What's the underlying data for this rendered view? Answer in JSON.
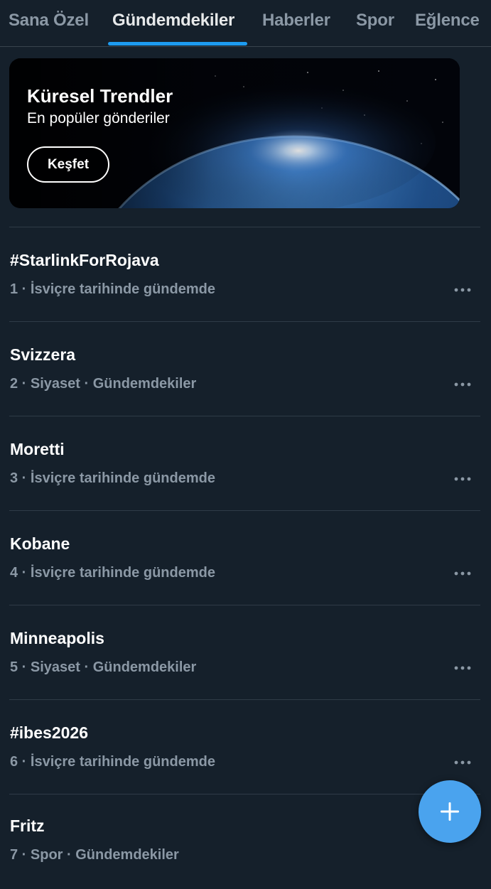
{
  "tabs": [
    {
      "label": "Sana Özel",
      "active": false
    },
    {
      "label": "Gündemdekiler",
      "active": true
    },
    {
      "label": "Haberler",
      "active": false
    },
    {
      "label": "Spor",
      "active": false
    },
    {
      "label": "Eğlence",
      "active": false
    }
  ],
  "banner": {
    "title": "Küresel Trendler",
    "subtitle": "En popüler gönderiler",
    "button_label": "Keşfet"
  },
  "trends": [
    {
      "name": "#StarlinkForRojava",
      "meta": "1 · İsviçre tarihinde gündemde"
    },
    {
      "name": "Svizzera",
      "meta": "2 · Siyaset · Gündemdekiler"
    },
    {
      "name": "Moretti",
      "meta": "3 · İsviçre tarihinde gündemde"
    },
    {
      "name": "Kobane",
      "meta": "4 · İsviçre tarihinde gündemde"
    },
    {
      "name": "Minneapolis",
      "meta": "5 · Siyaset · Gündemdekiler"
    },
    {
      "name": "#ibes2026",
      "meta": "6 · İsviçre tarihinde gündemde"
    },
    {
      "name": "Fritz",
      "meta": "7 · Spor · Gündemdekiler"
    }
  ],
  "icons": {
    "more": "more-horizontal-icon",
    "compose": "plus-icon"
  },
  "colors": {
    "background": "#15202b",
    "accent": "#1d9bf0",
    "fab": "#4aa3ee",
    "secondary_text": "#8b98a5"
  }
}
